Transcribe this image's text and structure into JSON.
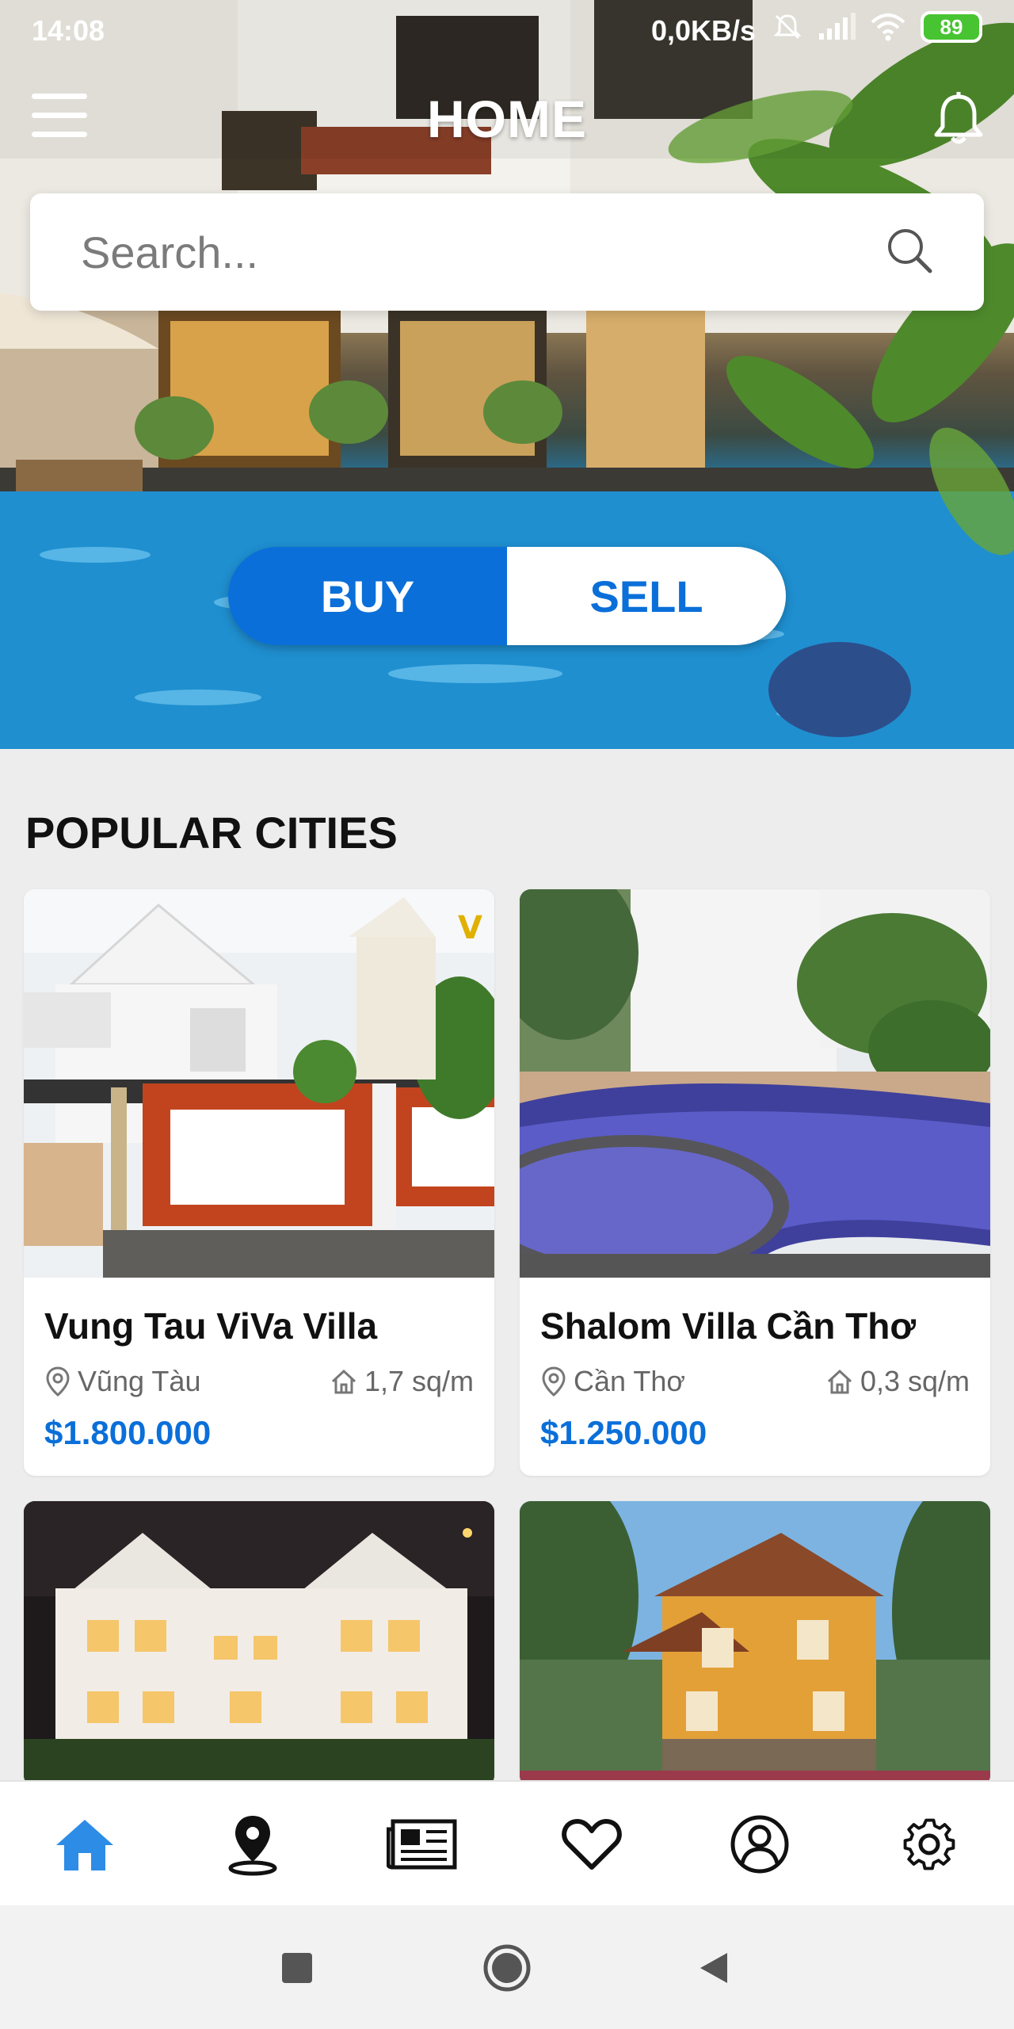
{
  "status_bar": {
    "time": "14:08",
    "network_speed": "0,0KB/s",
    "battery": "89"
  },
  "header": {
    "title": "HOME"
  },
  "search": {
    "placeholder": "Search..."
  },
  "mode_toggle": {
    "buy_label": "BUY",
    "sell_label": "SELL",
    "active": "BUY"
  },
  "popular": {
    "title": "POPULAR CITIES",
    "cards": [
      {
        "name": "Vung Tau ViVa Villa",
        "location": "Vũng Tàu",
        "area": "1,7 sq/m",
        "price": "$1.800.000"
      },
      {
        "name": "Shalom Villa Cần Thơ",
        "location": "Cần Thơ",
        "area": "0,3 sq/m",
        "price": "$1.250.000"
      }
    ]
  },
  "bottom_nav": {
    "items": [
      {
        "icon": "home-icon",
        "active": true
      },
      {
        "icon": "map-pin-icon",
        "active": false
      },
      {
        "icon": "news-icon",
        "active": false
      },
      {
        "icon": "heart-icon",
        "active": false
      },
      {
        "icon": "profile-icon",
        "active": false
      },
      {
        "icon": "settings-icon",
        "active": false
      }
    ]
  },
  "colors": {
    "accent": "#0a6fd8",
    "home_active": "#2d8de6",
    "background": "#ededed"
  }
}
